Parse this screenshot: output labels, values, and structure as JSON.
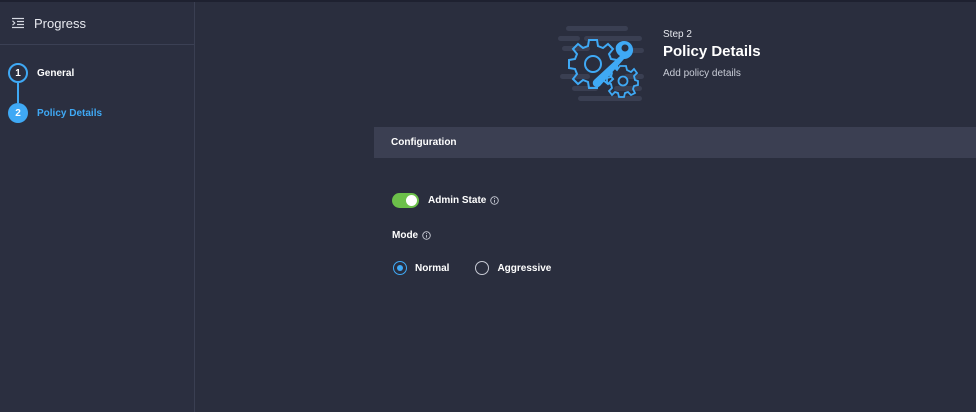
{
  "sidebar": {
    "title": "Progress",
    "icon": "list-indent-icon",
    "steps": [
      {
        "number": "1",
        "label": "General",
        "state": "completed"
      },
      {
        "number": "2",
        "label": "Policy Details",
        "state": "active"
      }
    ]
  },
  "header": {
    "kicker": "Step 2",
    "title": "Policy Details",
    "subtitle": "Add policy details",
    "graphic": "gears-wrench-illustration"
  },
  "section": {
    "title": "Configuration"
  },
  "form": {
    "admin_state": {
      "label": "Admin State",
      "enabled": true
    },
    "mode": {
      "label": "Mode",
      "options": [
        {
          "label": "Normal",
          "selected": true
        },
        {
          "label": "Aggressive",
          "selected": false
        }
      ]
    }
  },
  "colors": {
    "background": "#2a2e3e",
    "accent": "#3fa9f5",
    "toggle_on": "#6cc04a",
    "section_bar": "#3b3f52"
  }
}
